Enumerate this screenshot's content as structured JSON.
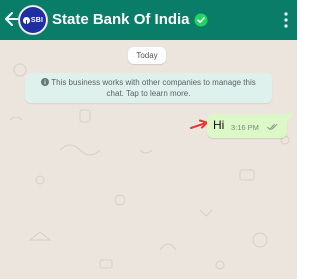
{
  "header": {
    "title": "State Bank Of India",
    "avatar_text": "SBI",
    "back_icon": "arrow-left-icon",
    "verified_icon": "verified-check-icon",
    "menu_icon": "more-vertical-icon",
    "bg_color": "#0a7d68"
  },
  "chat": {
    "date_label": "Today",
    "notice": "This business works with other companies to manage this chat. Tap to learn more.",
    "notice_icon": "info-icon",
    "messages": [
      {
        "text": "Hi",
        "time": "3:16 PM",
        "status_icon": "double-check-icon",
        "outgoing": true
      }
    ],
    "annotation_icon": "red-arrow-icon"
  },
  "colors": {
    "wallpaper": "#ece5dd",
    "outgoing_bubble": "#dcf8c6",
    "notice_bg": "#dff1ec",
    "verified": "#25d366",
    "annotation": "#e53935"
  }
}
